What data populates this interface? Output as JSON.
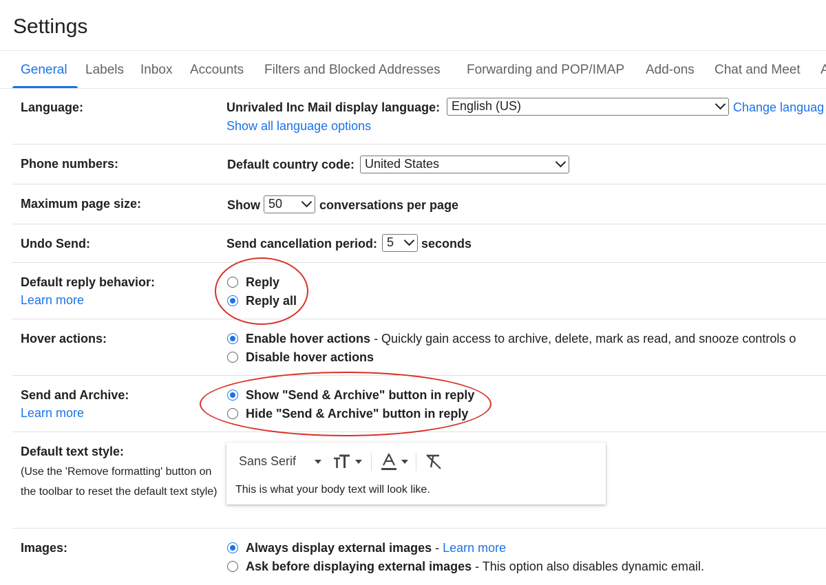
{
  "page": {
    "title": "Settings"
  },
  "tabs": [
    {
      "label": "General",
      "active": true
    },
    {
      "label": "Labels"
    },
    {
      "label": "Inbox"
    },
    {
      "label": "Accounts"
    },
    {
      "label": "Filters and Blocked Addresses"
    },
    {
      "label": "Forwarding and POP/IMAP"
    },
    {
      "label": "Add-ons"
    },
    {
      "label": "Chat and Meet"
    },
    {
      "label": "A"
    }
  ],
  "language": {
    "label": "Language:",
    "display_label": "Unrivaled Inc Mail display language:",
    "value": "English (US)",
    "change_link": "Change languag",
    "show_all_link": "Show all language options"
  },
  "phone": {
    "label": "Phone numbers:",
    "country_label": "Default country code:",
    "value": "United States"
  },
  "page_size": {
    "label": "Maximum page size:",
    "prefix": "Show",
    "value": "50",
    "suffix": "conversations per page"
  },
  "undo_send": {
    "label": "Undo Send:",
    "prefix": "Send cancellation period:",
    "value": "5",
    "suffix": "seconds"
  },
  "reply": {
    "label": "Default reply behavior:",
    "learn_more": "Learn more",
    "options": [
      {
        "label": "Reply",
        "selected": false
      },
      {
        "label": "Reply all",
        "selected": true
      }
    ]
  },
  "hover": {
    "label": "Hover actions:",
    "options": [
      {
        "label": "Enable hover actions",
        "desc": " - Quickly gain access to archive, delete, mark as read, and snooze controls o",
        "selected": true
      },
      {
        "label": "Disable hover actions",
        "selected": false
      }
    ]
  },
  "send_archive": {
    "label": "Send and Archive:",
    "learn_more": "Learn more",
    "options": [
      {
        "label": "Show \"Send & Archive\" button in reply",
        "selected": true
      },
      {
        "label": "Hide \"Send & Archive\" button in reply",
        "selected": false
      }
    ]
  },
  "text_style": {
    "label": "Default text style:",
    "note": "(Use the 'Remove formatting' button on the toolbar to reset the default text style)",
    "font": "Sans Serif",
    "preview": "This is what your body text will look like."
  },
  "images": {
    "label": "Images:",
    "options": [
      {
        "label": "Always display external images",
        "sep": " - ",
        "link": "Learn more",
        "selected": true
      },
      {
        "label": "Ask before displaying external images",
        "desc": " - This option also disables dynamic email.",
        "selected": false
      }
    ]
  },
  "colors": {
    "accent": "#1a73e8",
    "highlight": "#d93025",
    "divider": "#e0e0e0"
  }
}
